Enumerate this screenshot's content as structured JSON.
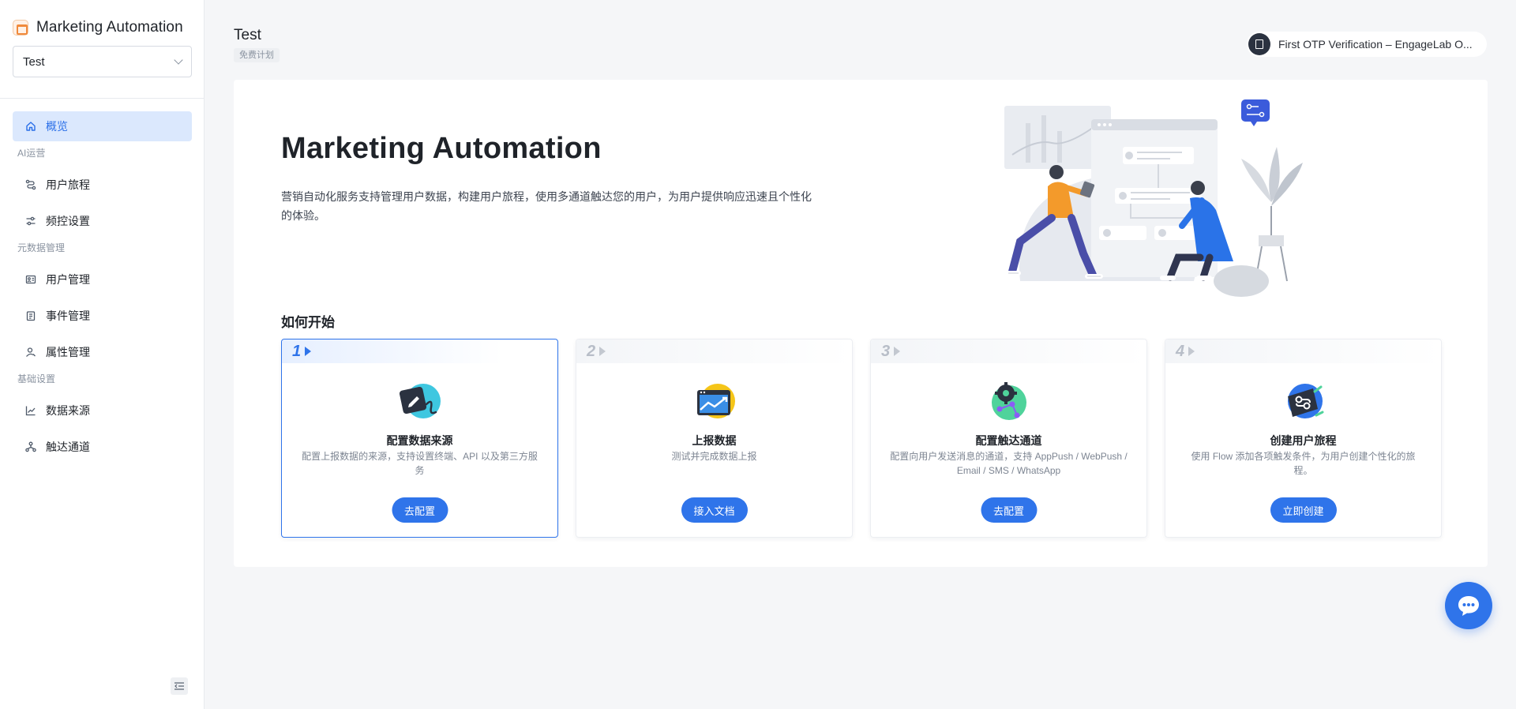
{
  "sidebar": {
    "brand": "Marketing Automation",
    "app_select": "Test",
    "items": [
      {
        "label": "概览"
      },
      {
        "label": "用户旅程"
      },
      {
        "label": "频控设置"
      },
      {
        "label": "用户管理"
      },
      {
        "label": "事件管理"
      },
      {
        "label": "属性管理"
      },
      {
        "label": "数据来源"
      },
      {
        "label": "触达通道"
      }
    ],
    "groups": [
      "AI运营",
      "元数据管理",
      "基础设置"
    ]
  },
  "header": {
    "title": "Test",
    "plan_badge": "免费计划",
    "doc_link": "First OTP Verification – EngageLab O..."
  },
  "hero": {
    "title": "Marketing Automation",
    "description": "营销自动化服务支持管理用户数据，构建用户旅程，使用多通道触达您的用户，为用户提供响应迅速且个性化的体验。"
  },
  "getting_started": {
    "title": "如何开始",
    "steps": [
      {
        "num": "1",
        "title": "配置数据来源",
        "desc": "配置上报数据的来源，支持设置终端、API 以及第三方服务",
        "button": "去配置"
      },
      {
        "num": "2",
        "title": "上报数据",
        "desc": "测试并完成数据上报",
        "button": "接入文档"
      },
      {
        "num": "3",
        "title": "配置触达通道",
        "desc": "配置向用户发送消息的通道，支持 AppPush / WebPush / Email / SMS / WhatsApp",
        "button": "去配置"
      },
      {
        "num": "4",
        "title": "创建用户旅程",
        "desc": "使用 Flow 添加各项触发条件，为用户创建个性化的旅程。",
        "button": "立即创建"
      }
    ]
  },
  "colors": {
    "primary": "#2f74ea",
    "active_nav_bg": "#dbe8fd"
  }
}
